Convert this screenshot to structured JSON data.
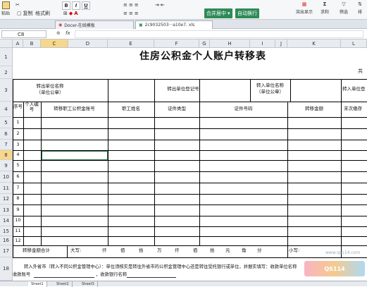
{
  "ribbon": {
    "paste": "粘贴",
    "copy": "复制",
    "format_painter": "格式刷",
    "merge_center": "合并居中",
    "wrap_text": "自动换行",
    "conditional": "突出显示",
    "sum": "求和",
    "filter": "筛选",
    "sort": "排"
  },
  "tabs": [
    {
      "label": "Docer-在线模板"
    },
    {
      "label": "2c9032503···a10e7. xls"
    }
  ],
  "formula_bar": {
    "cell_ref": "C8",
    "fx": "fx"
  },
  "columns": [
    "A",
    "B",
    "C",
    "D",
    "E",
    "F",
    "G",
    "H",
    "I",
    "J",
    "K",
    "L"
  ],
  "rows": [
    "1",
    "2",
    "3",
    "4",
    "5",
    "6",
    "7",
    "8",
    "9",
    "10",
    "11",
    "12",
    "13",
    "14",
    "15",
    "16",
    "17",
    "18"
  ],
  "sheet": {
    "title": "住房公积金个人账户转移表",
    "gong": "共",
    "out_unit_name": "转出单位名称",
    "out_unit_seal": "（单位公章）",
    "out_unit_reg": "转出单位登记号",
    "in_unit_name": "转入单位名称",
    "in_unit_seal": "（单位公章）",
    "in_unit_reg": "转入单位登",
    "col_seq": "序号",
    "col_person_no": "个人编号",
    "col_account": "转移职工公积金账号",
    "col_name": "职工姓名",
    "col_idtype": "证件类型",
    "col_idnum": "证件号码",
    "col_amount": "转移金额",
    "col_last": "末次缴存",
    "row_numbers": [
      "1",
      "2",
      "3",
      "4",
      "5",
      "6",
      "7",
      "8",
      "9",
      "10",
      "11",
      "12"
    ],
    "total_label": "转移金额合计",
    "daxie": "大写:",
    "units": [
      "仟",
      "佰",
      "拾",
      "万",
      "仟",
      "佰",
      "拾",
      "元",
      "角",
      "分"
    ],
    "xiaoxie": "小写:",
    "note1": "转入外省市（转入不同公积金管理中心）：单位须核实是转往外省市的公积金管理中心还是转往受托银行或单位，并据实填写：收款单位名称",
    "note2_a": "收款账号",
    "note2_b": "，收款银行名称"
  },
  "sheet_tabs": [
    "Sheet1",
    "Sheet2",
    "Sheet3"
  ],
  "watermark": "www.qs114.com"
}
